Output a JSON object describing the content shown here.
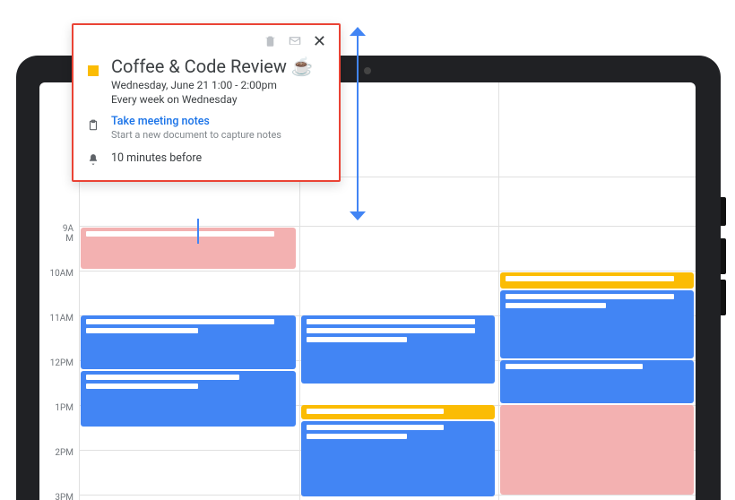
{
  "popup": {
    "title": "Coffee & Code Review ☕",
    "date_line": "Wednesday, June 21    1:00 - 2:00pm",
    "recurrence": "Every week on Wednesday",
    "notes_link": "Take meeting notes",
    "notes_sub": "Start a new document to capture notes",
    "reminder": "10 minutes before",
    "color": "#fbbc04"
  },
  "icons": {
    "trash": "trash-icon",
    "mail": "mail-icon",
    "close": "close-icon",
    "clipboard": "clipboard-icon",
    "bell": "bell-icon"
  },
  "times": [
    "9AM",
    "10AM",
    "11AM",
    "12PM",
    "1PM",
    "2PM",
    "3PM"
  ],
  "hour_height": 50,
  "colors": {
    "blue": "#4285f4",
    "orange": "#fbbc04",
    "pink": "#f3b1b1",
    "red_outline": "#ea4335"
  }
}
